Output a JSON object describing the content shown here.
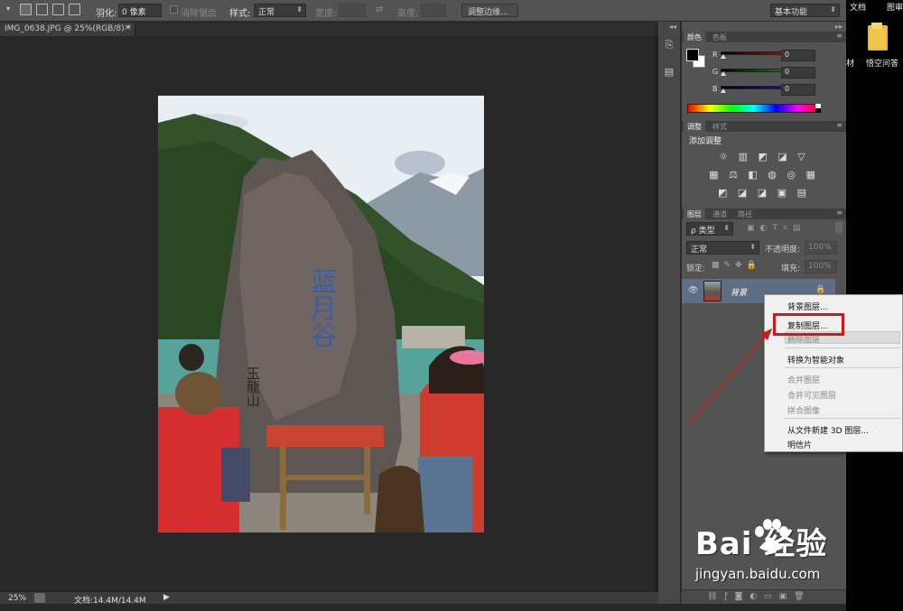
{
  "options_bar": {
    "feather_label": "羽化:",
    "feather_value": "0 像素",
    "antialias_label": "消除锯齿",
    "style_label": "样式:",
    "style_value": "正常",
    "width_label": "宽度:",
    "height_label": "高度:",
    "refine_edge_button": "调整边缘...",
    "workspace": "基本功能"
  },
  "document": {
    "tab_title": "IMG_0638.JPG @ 25%(RGB/8) *",
    "close": "×"
  },
  "status": {
    "zoom": "25%",
    "doc_info": "文档:14.4M/14.4M",
    "arrow": "▶"
  },
  "color_panel": {
    "tabs": [
      "颜色",
      "色板"
    ],
    "channels": [
      {
        "name": "R",
        "value": "0",
        "color": "#d01818"
      },
      {
        "name": "G",
        "value": "0",
        "color": "#1ea81e"
      },
      {
        "name": "B",
        "value": "0",
        "color": "#1e1ed0"
      }
    ]
  },
  "adjustments_panel": {
    "tabs": [
      "调整",
      "样式"
    ],
    "heading": "添加调整",
    "row1": "☼ ▥ ◩ ◪ ▽",
    "row2": "▦ ⚖ ◧ ◍ ◎ ▦",
    "row3": "◩ ◪ ◪ ▣ ▤"
  },
  "layers_panel": {
    "tabs": [
      "图层",
      "通道",
      "路径"
    ],
    "filter_label": "ρ 类型",
    "blend_mode": "正常",
    "opacity_label": "不透明度:",
    "opacity_value": "100%",
    "lock_label": "锁定:",
    "fill_label": "填充:",
    "fill_value": "100%",
    "layer_name": "背景"
  },
  "context_menu": {
    "items": [
      {
        "label": "背景图层...",
        "enabled": true
      },
      {
        "label": "复制图层...",
        "enabled": true
      },
      {
        "label": "删除图层",
        "enabled": false
      },
      {
        "label": "转换为智能对象",
        "enabled": true
      },
      {
        "label": "合并图层",
        "enabled": false
      },
      {
        "label": "合并可见图层",
        "enabled": false
      },
      {
        "label": "拼合图像",
        "enabled": false
      },
      {
        "label": "从文件新建 3D 图层...",
        "enabled": true
      },
      {
        "label": "明信片",
        "enabled": true
      }
    ]
  },
  "desktop": {
    "top_labels": [
      "文档",
      "图审"
    ],
    "folder_caption_left": "材",
    "folder_caption": "悟空问答"
  },
  "watermark": {
    "brand": "Bai  经验",
    "url": "jingyan.baidu.com"
  },
  "photo_text": {
    "carving_main": "蓝月谷",
    "carving_side": "玉龍山"
  }
}
